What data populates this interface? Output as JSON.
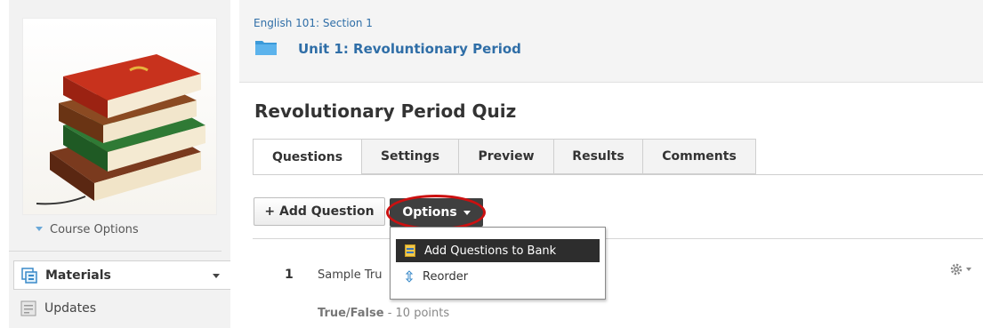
{
  "sidebar": {
    "course_options": "Course Options",
    "nav": [
      {
        "label": "Materials"
      },
      {
        "label": "Updates"
      }
    ]
  },
  "header": {
    "course": "English 101: Section 1",
    "unit": "Unit 1: Revoluntionary Period"
  },
  "page": {
    "title": "Revolutionary Period Quiz",
    "tabs": [
      {
        "label": "Questions",
        "active": true
      },
      {
        "label": "Settings"
      },
      {
        "label": "Preview"
      },
      {
        "label": "Results"
      },
      {
        "label": "Comments"
      }
    ]
  },
  "toolbar": {
    "add_question": "+ Add Question",
    "options": "Options"
  },
  "options_menu": {
    "items": [
      {
        "label": "Add Questions to Bank",
        "icon": "bank-icon"
      },
      {
        "label": "Reorder",
        "icon": "reorder-icon"
      }
    ]
  },
  "questions": [
    {
      "number": "1",
      "title": "Sample Tru",
      "type": "True/False",
      "points": " - 10 points"
    }
  ],
  "colors": {
    "link": "#2f6ea7",
    "dark_button": "#3f3f3f",
    "highlight": "#cc1010"
  }
}
